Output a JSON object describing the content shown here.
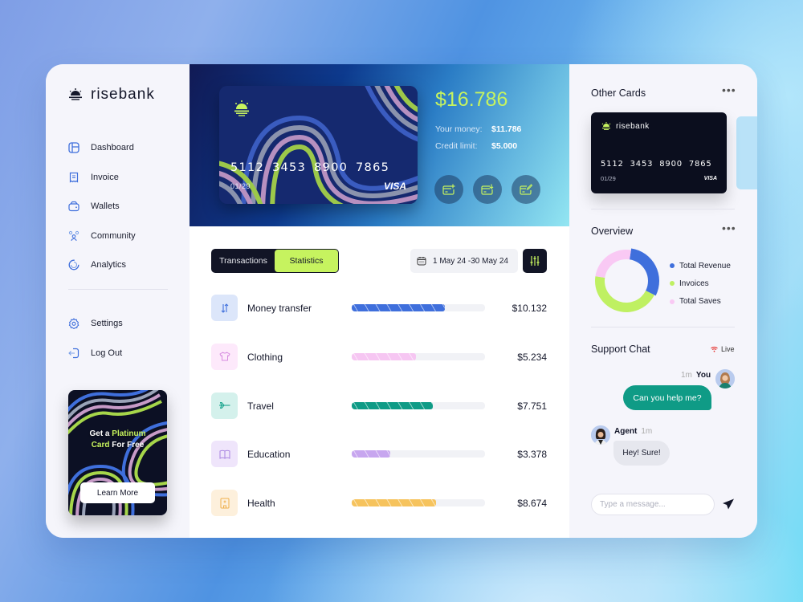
{
  "brand": {
    "name": "risebank"
  },
  "sidebar": {
    "items": [
      {
        "label": "Dashboard",
        "icon": "dashboard-icon"
      },
      {
        "label": "Invoice",
        "icon": "invoice-icon"
      },
      {
        "label": "Wallets",
        "icon": "wallet-icon"
      },
      {
        "label": "Community",
        "icon": "community-icon"
      },
      {
        "label": "Analytics",
        "icon": "analytics-icon"
      }
    ],
    "secondary": [
      {
        "label": "Settings",
        "icon": "gear-icon"
      },
      {
        "label": "Log Out",
        "icon": "logout-icon"
      }
    ],
    "promo": {
      "line1_prefix": "Get a ",
      "line1_highlight": "Platinum",
      "line2_highlight": "Card",
      "line2_suffix": " For Free",
      "button": "Learn More"
    }
  },
  "hero": {
    "card": {
      "number": "5112 3453 8900 7865",
      "expiry": "01/29",
      "network": "VISA"
    },
    "balance": "$16.786",
    "your_money_label": "Your money:",
    "your_money_value": "$11.786",
    "credit_limit_label": "Credit limit:",
    "credit_limit_value": "$5.000",
    "actions": [
      "add-card-icon",
      "card-download-icon",
      "card-edit-icon"
    ]
  },
  "toolbar": {
    "tabs": [
      {
        "label": "Transactions",
        "active": false
      },
      {
        "label": "Statistics",
        "active": true
      }
    ],
    "date_range": "1 May 24 -30 May 24"
  },
  "transactions": [
    {
      "name": "Money transfer",
      "amount": "$10.132",
      "progress": 0.7,
      "color": "#3f6fdc",
      "bg": "#dce6fa",
      "icon": "transfer-icon",
      "icon_color": "#3f6fdc"
    },
    {
      "name": "Clothing",
      "amount": "$5.234",
      "progress": 0.48,
      "color": "#f6c6f2",
      "bg": "#fde9fb",
      "icon": "tshirt-icon",
      "icon_color": "#d68be0"
    },
    {
      "name": "Travel",
      "amount": "$7.751",
      "progress": 0.61,
      "color": "#0f9b86",
      "bg": "#d4f1ec",
      "icon": "airplane-icon",
      "icon_color": "#1aa58e"
    },
    {
      "name": "Education",
      "amount": "$3.378",
      "progress": 0.29,
      "color": "#c7a6ef",
      "bg": "#efe5fb",
      "icon": "book-icon",
      "icon_color": "#a884e0"
    },
    {
      "name": "Health",
      "amount": "$8.674",
      "progress": 0.63,
      "color": "#f6c35d",
      "bg": "#fdf0dc",
      "icon": "hospital-icon",
      "icon_color": "#efb04c"
    }
  ],
  "right": {
    "other_cards_title": "Other Cards",
    "other_card": {
      "brand": "risebank",
      "number": "5112 3453 8900 7865",
      "expiry": "01/29",
      "network": "VISA"
    },
    "overview_title": "Overview",
    "chat_title": "Support Chat",
    "live_label": "Live",
    "messages": [
      {
        "from": "You",
        "time": "1m",
        "text": "Can you help me?"
      },
      {
        "from": "Agent",
        "time": "1m",
        "text": "Hey! Sure!"
      }
    ],
    "input_placeholder": "Type a message..."
  },
  "chart_data": {
    "type": "pie",
    "title": "Overview",
    "donut": true,
    "categories": [
      "Total Revenue",
      "Invoices",
      "Total Saves"
    ],
    "values": [
      30,
      45,
      25
    ],
    "colors": [
      "#3f6fdc",
      "#bff062",
      "#f9c9f4"
    ],
    "legend": "right"
  }
}
